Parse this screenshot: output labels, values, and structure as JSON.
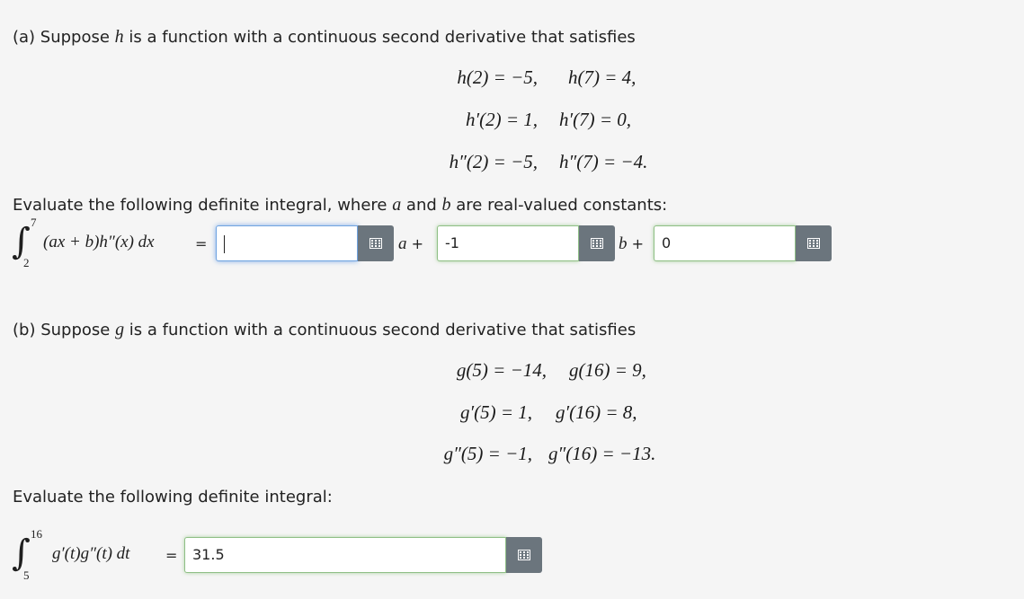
{
  "part_a": {
    "intro_prefix": "(a) Suppose ",
    "intro_var": "h",
    "intro_suffix": " is a function with a continuous second derivative that satisfies",
    "conditions": [
      {
        "left": "h(2) = −5,",
        "right": "h(7) = 4,"
      },
      {
        "left": "h′(2) = 1,",
        "right": "h′(7) = 0,"
      },
      {
        "left": "h″(2) = −5,",
        "right": "h″(7) = −4."
      }
    ],
    "prompt_prefix": "Evaluate the following definite integral, where ",
    "prompt_var_a": "a",
    "prompt_and": " and ",
    "prompt_var_b": "b",
    "prompt_suffix": " are real-valued constants:",
    "integral": {
      "upper": "7",
      "lower": "2",
      "integrand": "(ax + b)h″(x) dx",
      "equals": "="
    },
    "answers": {
      "const_value": "",
      "a_coeff_label": "a",
      "a_coeff_value": "-1",
      "b_coeff_label": "b",
      "b_coeff_value": "0",
      "plus": "+"
    }
  },
  "part_b": {
    "intro_prefix": "(b) Suppose ",
    "intro_var": "g",
    "intro_suffix": " is a function with a continuous second derivative that satisfies",
    "conditions": [
      {
        "left": "g(5) = −14,",
        "right": "g(16) = 9,"
      },
      {
        "left": "g′(5) = 1,",
        "right": "g′(16) = 8,"
      },
      {
        "left": "g″(5) = −1,",
        "right": "g″(16) = −13."
      }
    ],
    "prompt": "Evaluate the following definite integral:",
    "integral": {
      "upper": "16",
      "lower": "5",
      "integrand": "g′(t)g″(t) dt",
      "equals": "="
    },
    "answer_value": "31.5"
  },
  "icons": {
    "keyboard_button": "matrix-keypad-icon"
  },
  "colors": {
    "background": "#f5f5f5",
    "correct_border": "#8fbf86",
    "focus_border": "#6fa3e0",
    "button_bg": "#6b757d"
  }
}
